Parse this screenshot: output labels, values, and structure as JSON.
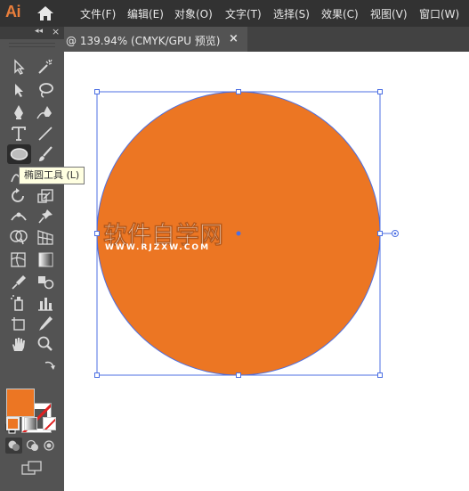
{
  "app": {
    "logo": "Ai"
  },
  "menu": [
    "文件(F)",
    "编辑(E)",
    "对象(O)",
    "文字(T)",
    "选择(S)",
    "效果(C)",
    "视图(V)",
    "窗口(W)"
  ],
  "document_tab": {
    "label": "@ 139.94% (CMYK/GPU 预览)",
    "close": "×"
  },
  "toolbox": {
    "collapse": "◂◂",
    "close": "×"
  },
  "tooltip": "椭圆工具 (L)",
  "colors": {
    "fill": "#EC7623",
    "selection": "#4C6FE3",
    "accent": "#E97E3B"
  },
  "watermark": {
    "title": "软件自学网",
    "url": "WWW.RJZXW.COM"
  }
}
